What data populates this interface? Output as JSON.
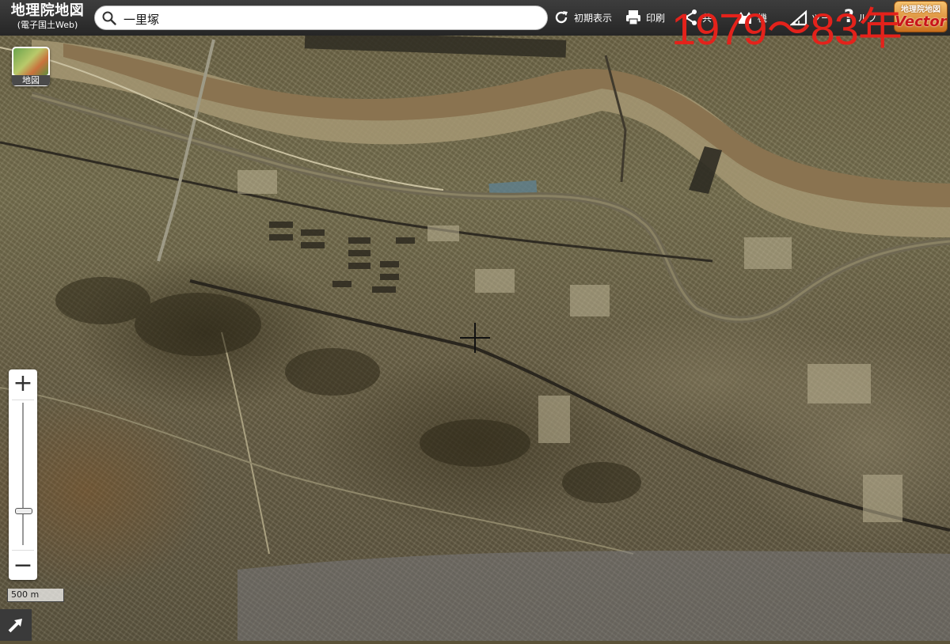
{
  "app": {
    "title": "地理院地図",
    "subtitle": "(電子国土Web)"
  },
  "search": {
    "value": "一里塚",
    "placeholder": ""
  },
  "toolbar": {
    "reset_label": "初期表示",
    "print_label": "印刷",
    "share_label": "共",
    "function_label": "機",
    "tools_label": "ツー",
    "help_label": "ルプ"
  },
  "badge": {
    "line1": "地理院地図",
    "line2": "Vector"
  },
  "map": {
    "era_label": "1979〜83年",
    "layer_button_label": "地図",
    "scale_label": "500 m",
    "zoom_in_label": "+",
    "zoom_out_label": "−",
    "zoom_level_fraction": 0.24,
    "colors": {
      "era_label": "#e4221b",
      "river_water": "#8a7350",
      "river_bank": "#a59266",
      "toolbar": "#2f2f2f"
    }
  }
}
